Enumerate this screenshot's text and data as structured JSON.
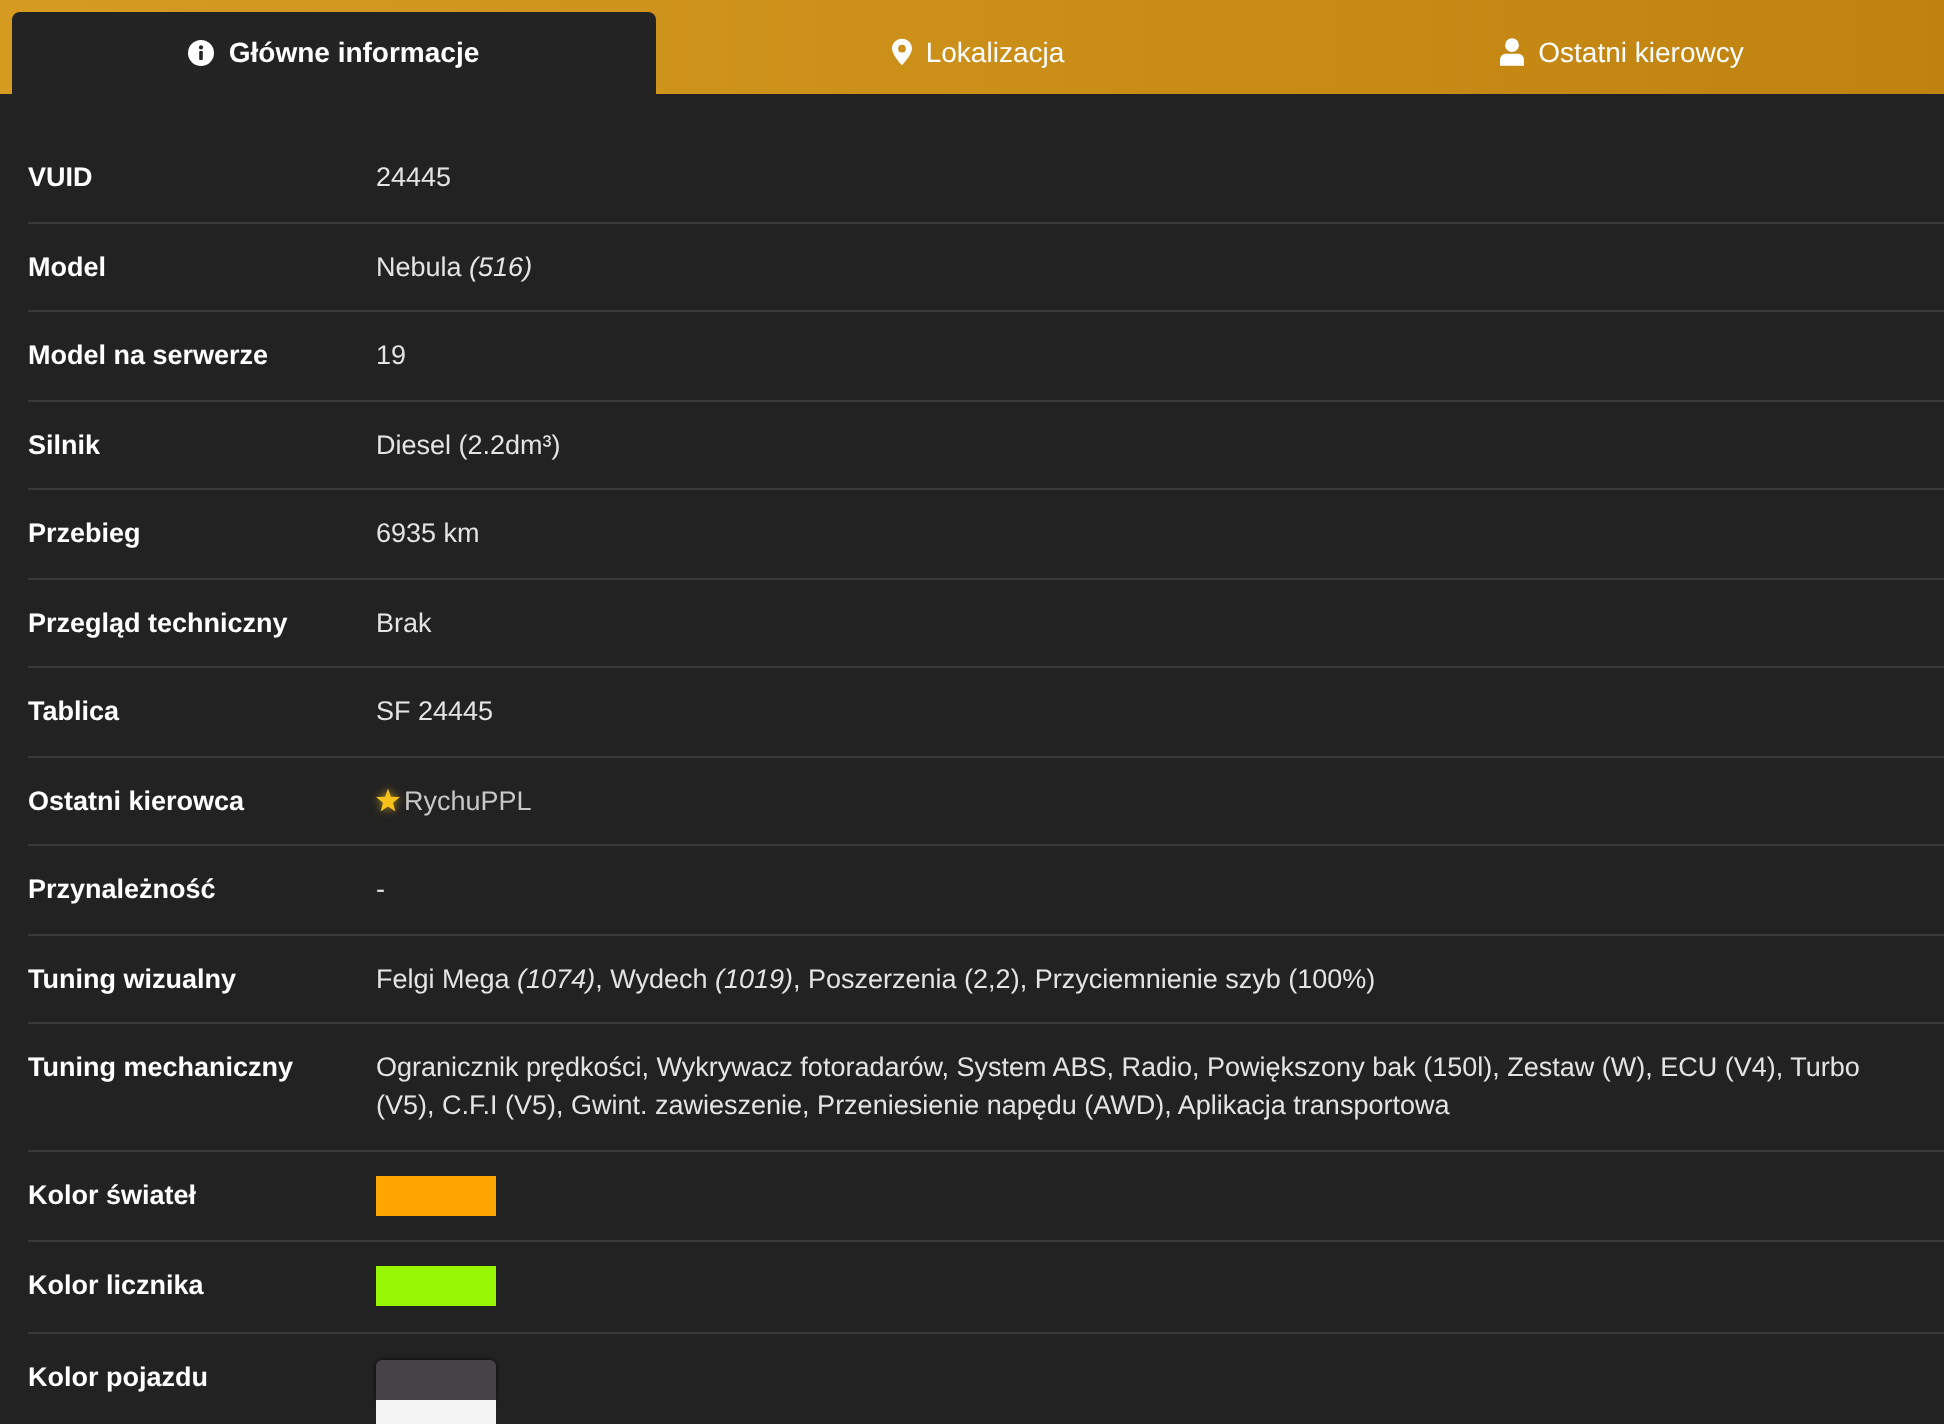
{
  "tabs": [
    {
      "label": "Główne informacje",
      "selected": true
    },
    {
      "label": "Lokalizacja",
      "selected": false
    },
    {
      "label": "Ostatni kierowcy",
      "selected": false
    }
  ],
  "rows": [
    {
      "kind": "text",
      "label": "VUID",
      "value": "24445"
    },
    {
      "kind": "text",
      "label": "Model",
      "value": "Nebula *(516)*"
    },
    {
      "kind": "text",
      "label": "Model na serwerze",
      "value": "19"
    },
    {
      "kind": "text",
      "label": "Silnik",
      "value": "Diesel (2.2dm³)"
    },
    {
      "kind": "text",
      "label": "Przebieg",
      "value": "6935 km"
    },
    {
      "kind": "text",
      "label": "Przegląd techniczny",
      "value": "Brak"
    },
    {
      "kind": "text",
      "label": "Tablica",
      "value": "SF 24445"
    },
    {
      "kind": "driver",
      "label": "Ostatni kierowca",
      "value": "RychuPPL",
      "starred": true
    },
    {
      "kind": "text",
      "label": "Przynależność",
      "value": "-"
    },
    {
      "kind": "text",
      "label": "Tuning wizualny",
      "value": "Felgi Mega *(1074)*, Wydech *(1019)*, Poszerzenia (2,2), Przyciemnienie szyb (100%)"
    },
    {
      "kind": "text",
      "label": "Tuning mechaniczny",
      "value": "Ogranicznik prędkości, Wykrywacz fotoradarów, System ABS, Radio, Powiększony bak (150l), Zestaw (W), ECU (V4), Turbo (V5), C.F.I (V5), Gwint. zawieszenie, Przeniesienie napędu (AWD), Aplikacja transportowa"
    },
    {
      "kind": "color",
      "label": "Kolor świateł",
      "color": "#ffa500"
    },
    {
      "kind": "color",
      "label": "Kolor licznika",
      "color": "#97f704"
    },
    {
      "kind": "colors",
      "label": "Kolor pojazdu",
      "colors": [
        {
          "color": "#464246"
        },
        {
          "color": "#f4f4f4"
        }
      ]
    }
  ]
}
